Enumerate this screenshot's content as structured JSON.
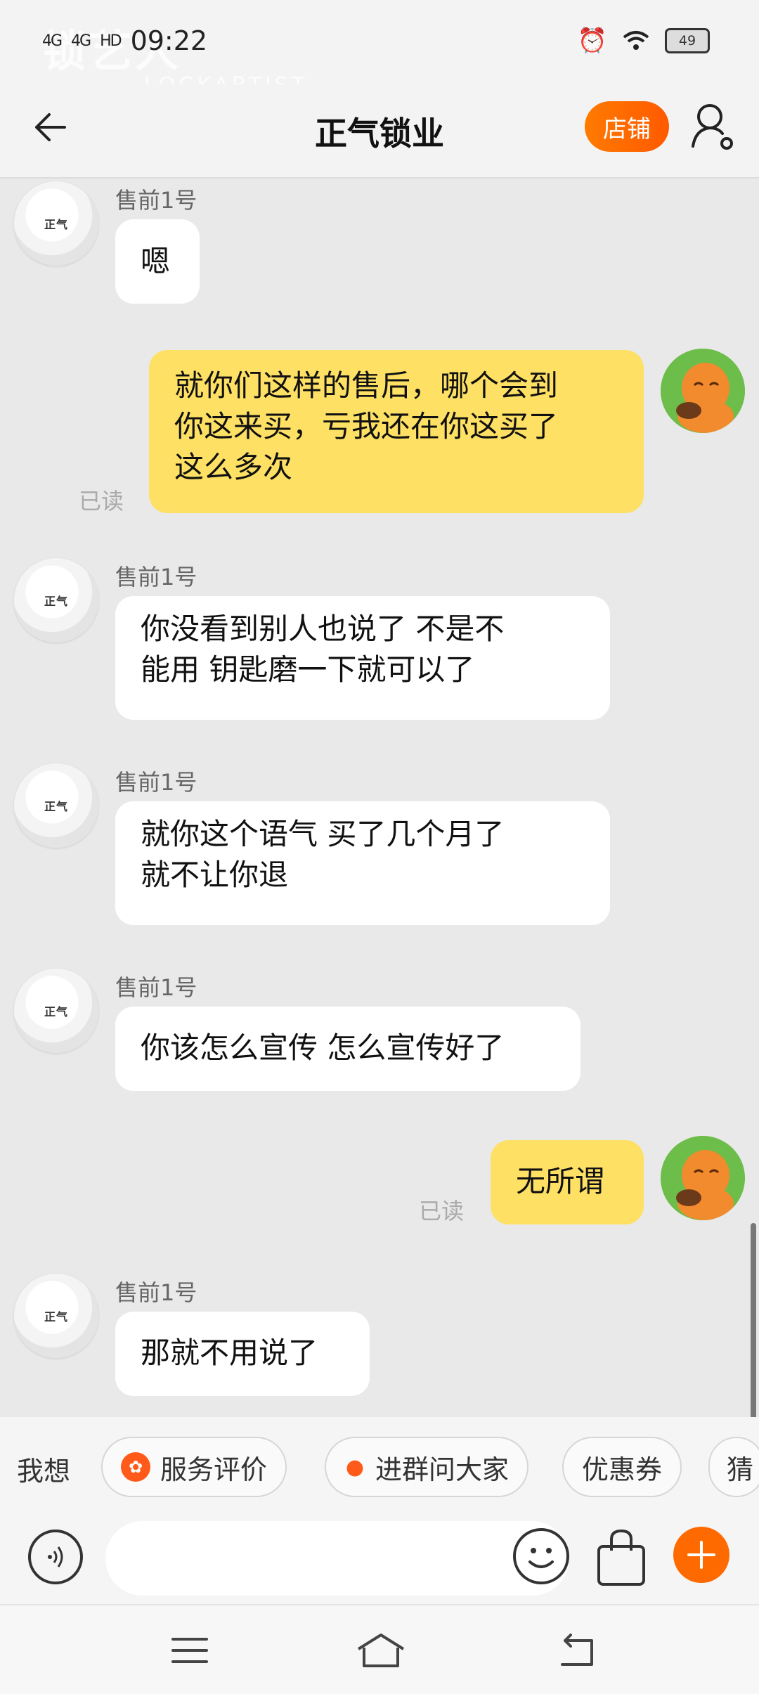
{
  "status": {
    "network": "4G",
    "signal_bars": "4G",
    "hd": "HD",
    "time": "09:22",
    "battery": "49"
  },
  "watermark": {
    "brand": "锁艺人",
    "sub": "LOCKARTIST"
  },
  "header": {
    "title": "正气锁业",
    "shop_label": "店铺"
  },
  "messages": [
    {
      "side": "shop",
      "sender": "售前1号",
      "text": "嗯"
    },
    {
      "side": "me",
      "lines": [
        "就你们这样的售后，哪个会到",
        "你这来买，亏我还在你这买了",
        "这么多次"
      ],
      "status": "已读"
    },
    {
      "side": "shop",
      "sender": "售前1号",
      "lines": [
        "你没看到别人也说了 不是不",
        "能用  钥匙磨一下就可以了"
      ]
    },
    {
      "side": "shop",
      "sender": "售前1号",
      "lines": [
        "就你这个语气 买了几个月了",
        "就不让你退"
      ]
    },
    {
      "side": "shop",
      "sender": "售前1号",
      "text": "你该怎么宣传 怎么宣传好了"
    },
    {
      "side": "me",
      "text": "无所谓",
      "status": "已读"
    },
    {
      "side": "shop",
      "sender": "售前1号",
      "text": "那就不用说了"
    }
  ],
  "shortcuts": {
    "want_label": "我想",
    "chips": [
      "服务评价",
      "进群问大家",
      "优惠券",
      "猜"
    ]
  },
  "input": {
    "placeholder": ""
  },
  "colors": {
    "accent": "#ff6a00",
    "my_bubble": "#fde064",
    "background": "#e9e9e9"
  },
  "icons": [
    "back-arrow-icon",
    "user-settings-icon",
    "voice-icon",
    "emoji-icon",
    "shopping-bag-icon",
    "plus-icon",
    "menu-icon",
    "home-icon",
    "return-icon"
  ]
}
